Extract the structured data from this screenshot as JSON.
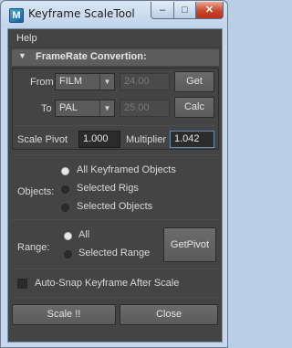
{
  "window": {
    "title": "Keyframe ScaleTool",
    "app_icon": "maya-icon",
    "controls": {
      "minimize": "–",
      "maximize": "□",
      "close": "✕"
    }
  },
  "menu": {
    "help": "Help"
  },
  "framerate": {
    "section_title": "FrameRate Convertion:",
    "from_label": "From",
    "from_value": "FILM",
    "from_fps": "24.00",
    "to_label": "To",
    "to_value": "PAL",
    "to_fps": "25.00",
    "get_label": "Get",
    "calc_label": "Calc",
    "dropdown_arrow": "▼"
  },
  "scale": {
    "pivot_label": "Scale Pivot",
    "pivot_value": "1.000",
    "multiplier_label": "Multiplier",
    "multiplier_value": "1.042"
  },
  "objects": {
    "label": "Objects:",
    "options": [
      "All Keyframed Objects",
      "Selected Rigs",
      "Selected Objects"
    ],
    "selected_index": 0
  },
  "range": {
    "label": "Range:",
    "options": [
      "All",
      "Selected Range"
    ],
    "selected_index": 0,
    "get_pivot_label": "GetPivot"
  },
  "auto_snap": {
    "label": "Auto-Snap Keyframe After Scale",
    "checked": false
  },
  "actions": {
    "scale_label": "Scale !!",
    "close_label": "Close"
  },
  "colors": {
    "panel_bg": "#444444",
    "field_bg": "#2b2b2b",
    "focus_border": "#6a8db5"
  }
}
